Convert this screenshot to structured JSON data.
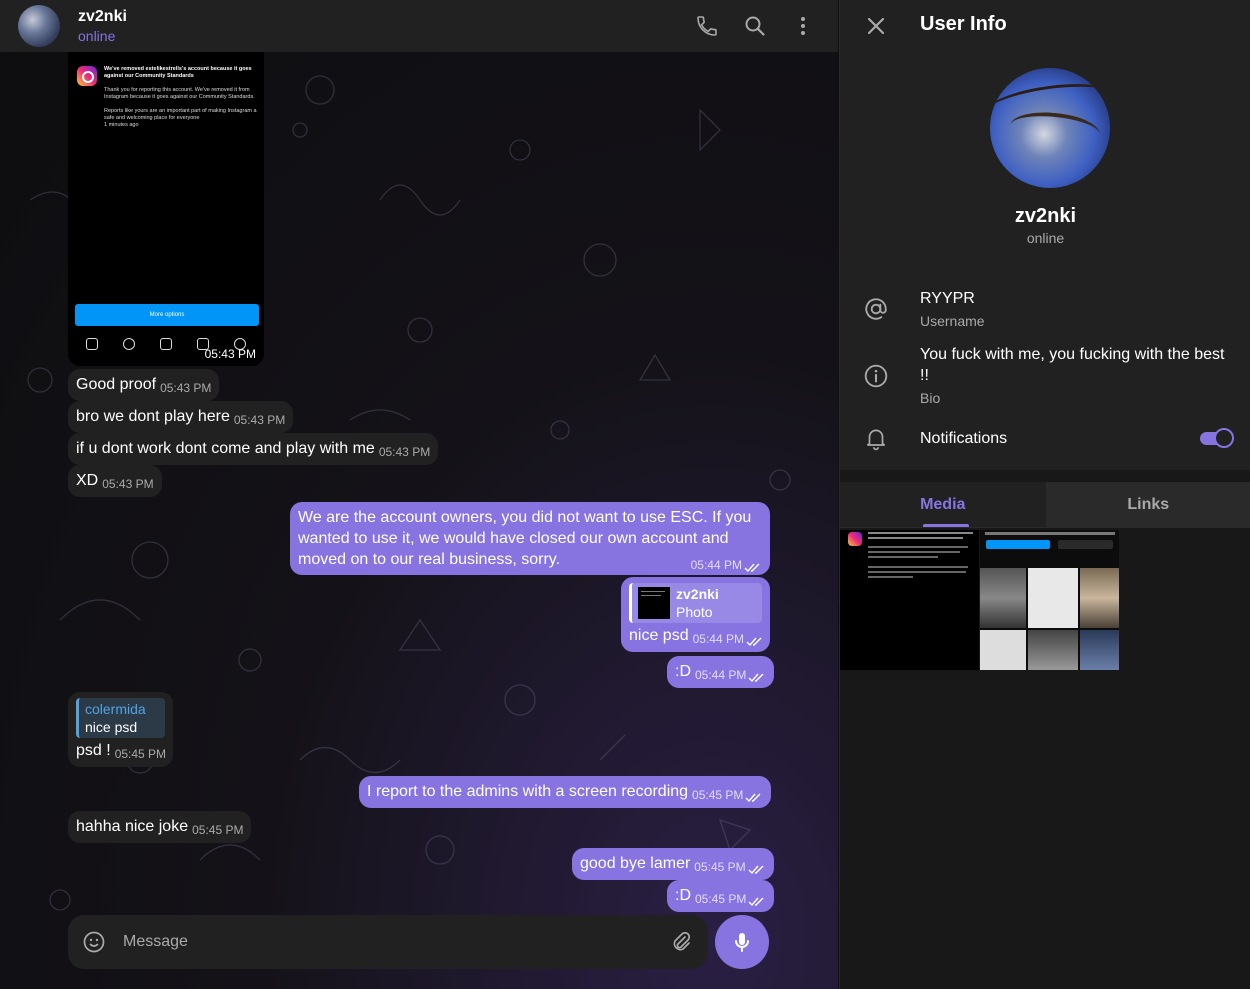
{
  "header": {
    "name": "zv2nki",
    "status": "online",
    "icons": [
      "phone-icon",
      "search-icon",
      "more-vertical-icon"
    ]
  },
  "screenshot_msg": {
    "ig_title": "We've removed estelikestrells's account because it goes against our Community Standards",
    "ig_body1": "Thank you for reporting this account. We've removed it from Instagram because it goes against our Community Standards.",
    "ig_body2": "Reports like yours are an important part of making Instagram a safe and welcoming place for everyone",
    "ig_ago": "1 minutes ago",
    "ig_button": "More options",
    "time": "05:43 PM"
  },
  "messages": [
    {
      "text": "Good proof",
      "time": "05:43 PM"
    },
    {
      "text": "bro we dont play here",
      "time": "05:43 PM"
    },
    {
      "text": "if u dont work dont come and play with me",
      "time": "05:43 PM"
    },
    {
      "text": "XD",
      "time": "05:43 PM"
    },
    {
      "text": "We are the account owners, you did not want to use ESC. If you wanted to use it, we would have closed our own account and moved on to our real business, sorry.",
      "time": "05:44 PM"
    },
    {
      "reply_name": "zv2nki",
      "reply_text": "Photo",
      "text": "nice psd",
      "time": "05:44 PM"
    },
    {
      "text": ":D",
      "time": "05:44 PM"
    },
    {
      "reply_name": "colermida",
      "reply_text": "nice psd",
      "text": "psd !",
      "time": "05:45 PM"
    },
    {
      "text": "I report to the admins with a screen recording",
      "time": "05:45 PM"
    },
    {
      "text": "hahha nice joke",
      "time": "05:45 PM"
    },
    {
      "text": "good bye lamer",
      "time": "05:45 PM"
    },
    {
      "text": ":D",
      "time": "05:45 PM"
    }
  ],
  "composer": {
    "placeholder": "Message"
  },
  "panel": {
    "title": "User Info",
    "name": "zv2nki",
    "status": "online",
    "username": "RYYPR",
    "username_label": "Username",
    "bio": "You fuck with me, you fucking with the best !!",
    "bio_label": "Bio",
    "notifications_label": "Notifications",
    "notifications_on": true,
    "tabs": [
      "Media",
      "Links"
    ],
    "active_tab": "Media"
  },
  "colors": {
    "accent": "#8774e1",
    "bubble_in": "#212121",
    "panel_bg": "#212121"
  }
}
